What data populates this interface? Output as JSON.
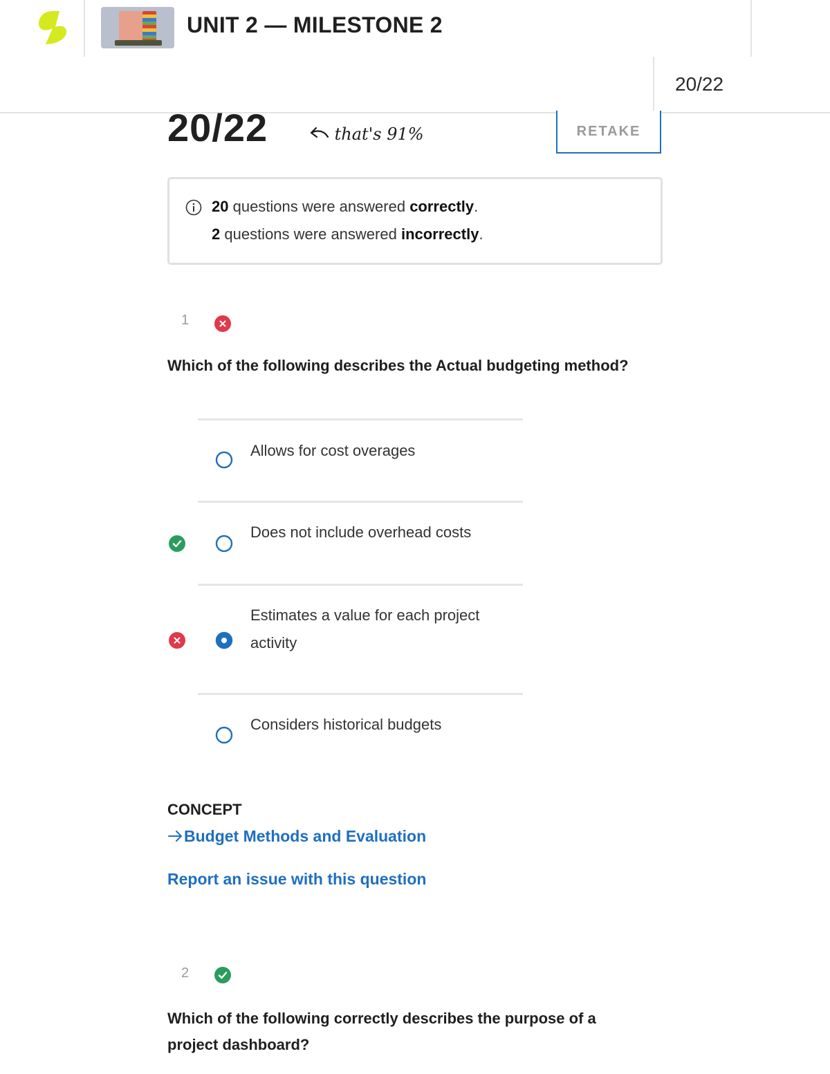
{
  "header": {
    "title": "UNIT 2 — MILESTONE 2",
    "score_corner": "20/22"
  },
  "result": {
    "score": "20/22",
    "note": "that's 91%",
    "retake_label": "RETAKE",
    "correct_count": "20",
    "correct_text": " questions were answered ",
    "correct_word": "correctly",
    "incorrect_count": "2",
    "incorrect_text": " questions were answered ",
    "incorrect_word": "incorrectly",
    "period": "."
  },
  "questions": [
    {
      "number": "1",
      "status": "incorrect",
      "text": "Which of the following describes the Actual budgeting method?",
      "options": [
        {
          "label": "Allows for cost overages",
          "selected": false,
          "mark": "none"
        },
        {
          "label": "Does not include overhead costs",
          "selected": false,
          "mark": "correct"
        },
        {
          "label": "Estimates a value for each project activity",
          "selected": true,
          "mark": "incorrect"
        },
        {
          "label": "Considers historical budgets",
          "selected": false,
          "mark": "none"
        }
      ],
      "concept_label": "CONCEPT",
      "concept_link": "Budget Methods and Evaluation",
      "report_link": "Report an issue with this question"
    },
    {
      "number": "2",
      "status": "correct",
      "text_line1": "Which of the following correctly describes the purpose of a",
      "text_line2": "project dashboard?"
    }
  ],
  "colors": {
    "accent_blue": "#1f6fbf",
    "correct_green": "#2a9d5c",
    "incorrect_red": "#e0394b",
    "logo_lime": "#d4ea1e"
  },
  "icons": [
    "logo-icon",
    "info-icon",
    "arrow-left-icon",
    "arrow-right-icon",
    "check-circle-icon",
    "x-circle-icon",
    "radio-icon"
  ]
}
